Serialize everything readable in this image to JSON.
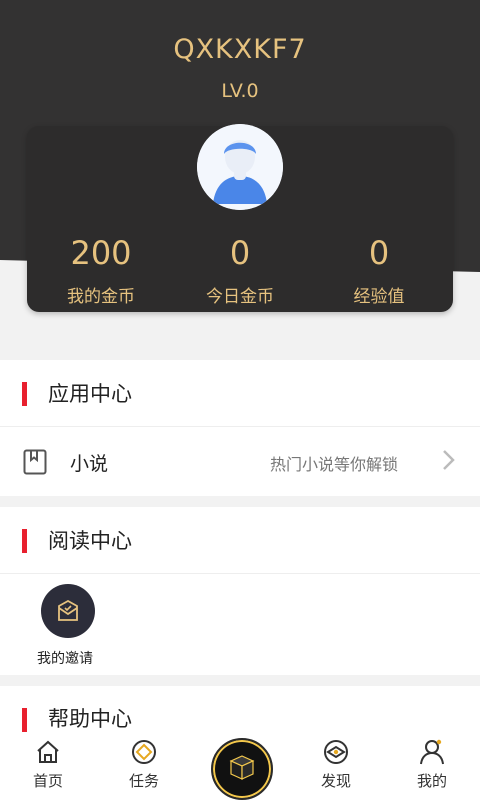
{
  "profile": {
    "username": "QXKXKF7",
    "level": "LV.0"
  },
  "stats": [
    {
      "value": "200",
      "label": "我的金币"
    },
    {
      "value": "0",
      "label": "今日金币"
    },
    {
      "value": "0",
      "label": "经验值"
    }
  ],
  "app_center": {
    "title": "应用中心",
    "novel": {
      "name": "小说",
      "hint": "热门小说等你解锁",
      "icon": "book-icon"
    }
  },
  "reading_center": {
    "title": "阅读中心",
    "invite": {
      "label": "我的邀请",
      "icon": "envelope-icon"
    }
  },
  "help_center": {
    "title": "帮助中心"
  },
  "tabbar": {
    "home": "首页",
    "tasks": "任务",
    "discover": "发现",
    "mine": "我的"
  },
  "colors": {
    "gold": "#e6c27f",
    "dark": "#333232",
    "accent": "#e8202e"
  }
}
